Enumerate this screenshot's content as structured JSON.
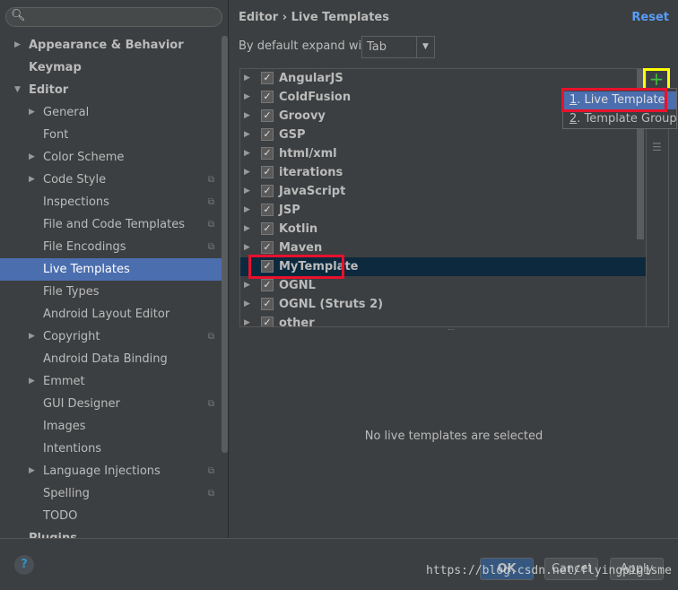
{
  "search": {
    "placeholder": ""
  },
  "sidebar": {
    "items": [
      {
        "label": "Appearance & Behavior",
        "level": 0,
        "arrow": "▶",
        "bold": true
      },
      {
        "label": "Keymap",
        "level": 0,
        "bold": true
      },
      {
        "label": "Editor",
        "level": 0,
        "arrow": "▼",
        "bold": true
      },
      {
        "label": "General",
        "level": 1,
        "arrow": "▶"
      },
      {
        "label": "Font",
        "level": 1
      },
      {
        "label": "Color Scheme",
        "level": 1,
        "arrow": "▶"
      },
      {
        "label": "Code Style",
        "level": 1,
        "arrow": "▶",
        "copy": true
      },
      {
        "label": "Inspections",
        "level": 1,
        "copy": true
      },
      {
        "label": "File and Code Templates",
        "level": 1,
        "copy": true
      },
      {
        "label": "File Encodings",
        "level": 1,
        "copy": true
      },
      {
        "label": "Live Templates",
        "level": 1,
        "selected": true
      },
      {
        "label": "File Types",
        "level": 1
      },
      {
        "label": "Android Layout Editor",
        "level": 1
      },
      {
        "label": "Copyright",
        "level": 1,
        "arrow": "▶",
        "copy": true
      },
      {
        "label": "Android Data Binding",
        "level": 1
      },
      {
        "label": "Emmet",
        "level": 1,
        "arrow": "▶"
      },
      {
        "label": "GUI Designer",
        "level": 1,
        "copy": true
      },
      {
        "label": "Images",
        "level": 1
      },
      {
        "label": "Intentions",
        "level": 1
      },
      {
        "label": "Language Injections",
        "level": 1,
        "arrow": "▶",
        "copy": true
      },
      {
        "label": "Spelling",
        "level": 1,
        "copy": true
      },
      {
        "label": "TODO",
        "level": 1
      },
      {
        "label": "Plugins",
        "level": 0,
        "bold": true
      }
    ]
  },
  "header": {
    "breadcrumb": "Editor › Live Templates",
    "reset": "Reset"
  },
  "expand": {
    "label": "By default expand with",
    "value": "Tab"
  },
  "tree": [
    {
      "label": "AngularJS"
    },
    {
      "label": "ColdFusion"
    },
    {
      "label": "Groovy"
    },
    {
      "label": "GSP"
    },
    {
      "label": "html/xml"
    },
    {
      "label": "iterations"
    },
    {
      "label": "JavaScript"
    },
    {
      "label": "JSP"
    },
    {
      "label": "Kotlin"
    },
    {
      "label": "Maven"
    },
    {
      "label": "MyTemplate",
      "selected": true,
      "noarrow": true
    },
    {
      "label": "OGNL"
    },
    {
      "label": "OGNL (Struts 2)"
    },
    {
      "label": "other"
    }
  ],
  "popup": {
    "items": [
      {
        "key": "1",
        "label": ". Live Template"
      },
      {
        "key": "2",
        "label": ". Template Group..."
      }
    ]
  },
  "empty_text": "No live templates are selected",
  "footer": {
    "help": "?",
    "ok": "OK",
    "cancel": "Cancel",
    "apply": "Apply"
  },
  "watermark": "https://blog.csdn.net/flyingpigisme",
  "colors": {
    "selection": "#4b6eaf",
    "tree_selection": "#0d293e",
    "highlight_red": "#e8112d",
    "highlight_yellow": "#ffff00",
    "add_green": "#3fbf3f",
    "link": "#589df6"
  }
}
